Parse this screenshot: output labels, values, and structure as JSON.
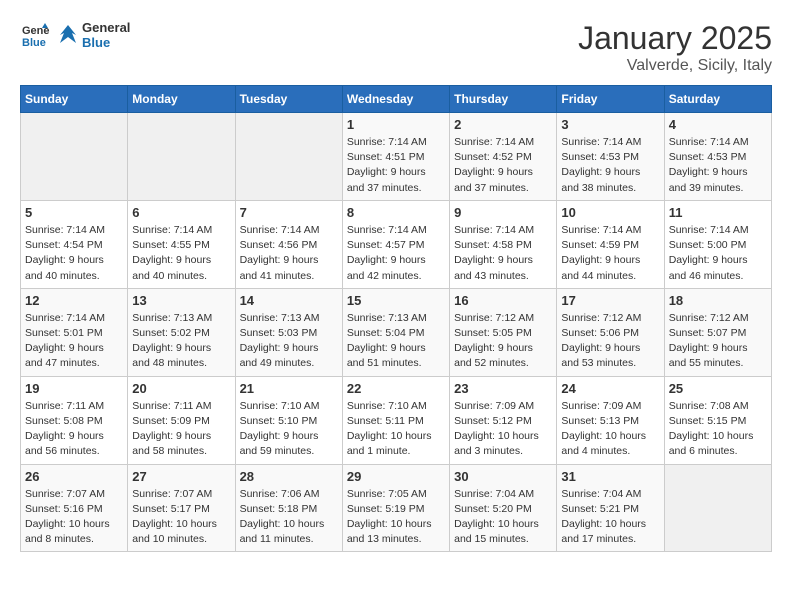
{
  "header": {
    "logo_line1": "General",
    "logo_line2": "Blue",
    "month": "January 2025",
    "location": "Valverde, Sicily, Italy"
  },
  "weekdays": [
    "Sunday",
    "Monday",
    "Tuesday",
    "Wednesday",
    "Thursday",
    "Friday",
    "Saturday"
  ],
  "weeks": [
    [
      {
        "day": "",
        "info": ""
      },
      {
        "day": "",
        "info": ""
      },
      {
        "day": "",
        "info": ""
      },
      {
        "day": "1",
        "info": "Sunrise: 7:14 AM\nSunset: 4:51 PM\nDaylight: 9 hours and 37 minutes."
      },
      {
        "day": "2",
        "info": "Sunrise: 7:14 AM\nSunset: 4:52 PM\nDaylight: 9 hours and 37 minutes."
      },
      {
        "day": "3",
        "info": "Sunrise: 7:14 AM\nSunset: 4:53 PM\nDaylight: 9 hours and 38 minutes."
      },
      {
        "day": "4",
        "info": "Sunrise: 7:14 AM\nSunset: 4:53 PM\nDaylight: 9 hours and 39 minutes."
      }
    ],
    [
      {
        "day": "5",
        "info": "Sunrise: 7:14 AM\nSunset: 4:54 PM\nDaylight: 9 hours and 40 minutes."
      },
      {
        "day": "6",
        "info": "Sunrise: 7:14 AM\nSunset: 4:55 PM\nDaylight: 9 hours and 40 minutes."
      },
      {
        "day": "7",
        "info": "Sunrise: 7:14 AM\nSunset: 4:56 PM\nDaylight: 9 hours and 41 minutes."
      },
      {
        "day": "8",
        "info": "Sunrise: 7:14 AM\nSunset: 4:57 PM\nDaylight: 9 hours and 42 minutes."
      },
      {
        "day": "9",
        "info": "Sunrise: 7:14 AM\nSunset: 4:58 PM\nDaylight: 9 hours and 43 minutes."
      },
      {
        "day": "10",
        "info": "Sunrise: 7:14 AM\nSunset: 4:59 PM\nDaylight: 9 hours and 44 minutes."
      },
      {
        "day": "11",
        "info": "Sunrise: 7:14 AM\nSunset: 5:00 PM\nDaylight: 9 hours and 46 minutes."
      }
    ],
    [
      {
        "day": "12",
        "info": "Sunrise: 7:14 AM\nSunset: 5:01 PM\nDaylight: 9 hours and 47 minutes."
      },
      {
        "day": "13",
        "info": "Sunrise: 7:13 AM\nSunset: 5:02 PM\nDaylight: 9 hours and 48 minutes."
      },
      {
        "day": "14",
        "info": "Sunrise: 7:13 AM\nSunset: 5:03 PM\nDaylight: 9 hours and 49 minutes."
      },
      {
        "day": "15",
        "info": "Sunrise: 7:13 AM\nSunset: 5:04 PM\nDaylight: 9 hours and 51 minutes."
      },
      {
        "day": "16",
        "info": "Sunrise: 7:12 AM\nSunset: 5:05 PM\nDaylight: 9 hours and 52 minutes."
      },
      {
        "day": "17",
        "info": "Sunrise: 7:12 AM\nSunset: 5:06 PM\nDaylight: 9 hours and 53 minutes."
      },
      {
        "day": "18",
        "info": "Sunrise: 7:12 AM\nSunset: 5:07 PM\nDaylight: 9 hours and 55 minutes."
      }
    ],
    [
      {
        "day": "19",
        "info": "Sunrise: 7:11 AM\nSunset: 5:08 PM\nDaylight: 9 hours and 56 minutes."
      },
      {
        "day": "20",
        "info": "Sunrise: 7:11 AM\nSunset: 5:09 PM\nDaylight: 9 hours and 58 minutes."
      },
      {
        "day": "21",
        "info": "Sunrise: 7:10 AM\nSunset: 5:10 PM\nDaylight: 9 hours and 59 minutes."
      },
      {
        "day": "22",
        "info": "Sunrise: 7:10 AM\nSunset: 5:11 PM\nDaylight: 10 hours and 1 minute."
      },
      {
        "day": "23",
        "info": "Sunrise: 7:09 AM\nSunset: 5:12 PM\nDaylight: 10 hours and 3 minutes."
      },
      {
        "day": "24",
        "info": "Sunrise: 7:09 AM\nSunset: 5:13 PM\nDaylight: 10 hours and 4 minutes."
      },
      {
        "day": "25",
        "info": "Sunrise: 7:08 AM\nSunset: 5:15 PM\nDaylight: 10 hours and 6 minutes."
      }
    ],
    [
      {
        "day": "26",
        "info": "Sunrise: 7:07 AM\nSunset: 5:16 PM\nDaylight: 10 hours and 8 minutes."
      },
      {
        "day": "27",
        "info": "Sunrise: 7:07 AM\nSunset: 5:17 PM\nDaylight: 10 hours and 10 minutes."
      },
      {
        "day": "28",
        "info": "Sunrise: 7:06 AM\nSunset: 5:18 PM\nDaylight: 10 hours and 11 minutes."
      },
      {
        "day": "29",
        "info": "Sunrise: 7:05 AM\nSunset: 5:19 PM\nDaylight: 10 hours and 13 minutes."
      },
      {
        "day": "30",
        "info": "Sunrise: 7:04 AM\nSunset: 5:20 PM\nDaylight: 10 hours and 15 minutes."
      },
      {
        "day": "31",
        "info": "Sunrise: 7:04 AM\nSunset: 5:21 PM\nDaylight: 10 hours and 17 minutes."
      },
      {
        "day": "",
        "info": ""
      }
    ]
  ]
}
